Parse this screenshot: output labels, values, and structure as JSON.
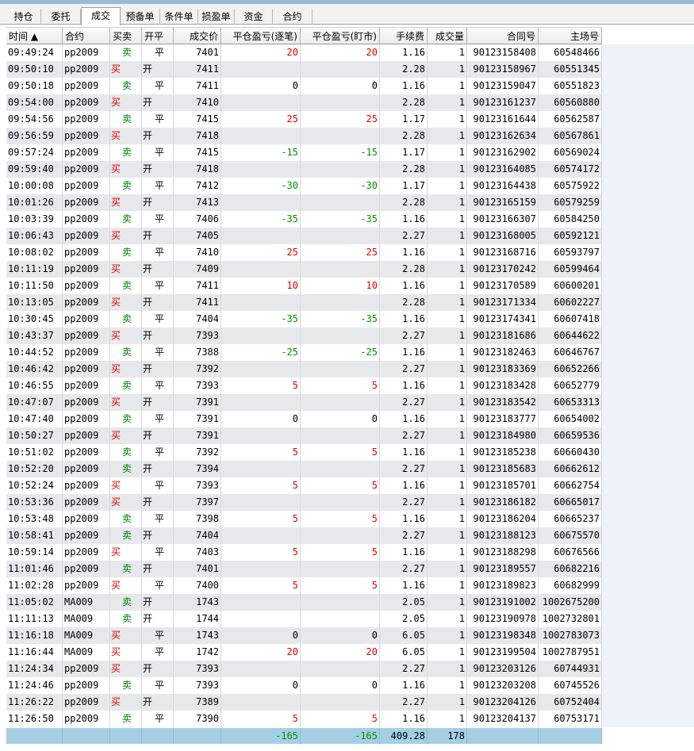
{
  "tabs": [
    {
      "label": "持仓",
      "active": false
    },
    {
      "label": "委托",
      "active": false
    },
    {
      "label": "成交",
      "active": true
    },
    {
      "label": "预备单",
      "active": false
    },
    {
      "label": "条件单",
      "active": false
    },
    {
      "label": "损盈单",
      "active": false
    },
    {
      "label": "资金",
      "active": false
    },
    {
      "label": "合约",
      "active": false
    }
  ],
  "columns": [
    "时间 ▲",
    "合约",
    "买卖",
    "开平",
    "成交价",
    "平仓盈亏(逐笔)",
    "平仓盈亏(盯市)",
    "手续费",
    "成交量",
    "合同号",
    "主场号"
  ],
  "colors": {
    "buy": "#e00000",
    "sell": "#008000",
    "loss": "#009000",
    "profit": "#e00000",
    "total_bg": "#a6cfe6"
  },
  "rows": [
    [
      "09:49:24",
      "pp2009",
      "卖",
      "平",
      "7401",
      "20",
      "20",
      "1.16",
      "1",
      "90123158408",
      "60548466"
    ],
    [
      "09:50:10",
      "pp2009",
      "买",
      "开",
      "7411",
      "",
      "",
      "2.28",
      "1",
      "90123158967",
      "60551345"
    ],
    [
      "09:50:18",
      "pp2009",
      "卖",
      "平",
      "7411",
      "0",
      "0",
      "1.16",
      "1",
      "90123159047",
      "60551823"
    ],
    [
      "09:54:00",
      "pp2009",
      "买",
      "开",
      "7410",
      "",
      "",
      "2.28",
      "1",
      "90123161237",
      "60560880"
    ],
    [
      "09:54:56",
      "pp2009",
      "卖",
      "平",
      "7415",
      "25",
      "25",
      "1.17",
      "1",
      "90123161644",
      "60562587"
    ],
    [
      "09:56:59",
      "pp2009",
      "买",
      "开",
      "7418",
      "",
      "",
      "2.28",
      "1",
      "90123162634",
      "60567861"
    ],
    [
      "09:57:24",
      "pp2009",
      "卖",
      "平",
      "7415",
      "-15",
      "-15",
      "1.17",
      "1",
      "90123162902",
      "60569024"
    ],
    [
      "09:59:40",
      "pp2009",
      "买",
      "开",
      "7418",
      "",
      "",
      "2.28",
      "1",
      "90123164085",
      "60574172"
    ],
    [
      "10:00:08",
      "pp2009",
      "卖",
      "平",
      "7412",
      "-30",
      "-30",
      "1.17",
      "1",
      "90123164438",
      "60575922"
    ],
    [
      "10:01:26",
      "pp2009",
      "买",
      "开",
      "7413",
      "",
      "",
      "2.28",
      "1",
      "90123165159",
      "60579259"
    ],
    [
      "10:03:39",
      "pp2009",
      "卖",
      "平",
      "7406",
      "-35",
      "-35",
      "1.16",
      "1",
      "90123166307",
      "60584250"
    ],
    [
      "10:06:43",
      "pp2009",
      "买",
      "开",
      "7405",
      "",
      "",
      "2.27",
      "1",
      "90123168005",
      "60592121"
    ],
    [
      "10:08:02",
      "pp2009",
      "卖",
      "平",
      "7410",
      "25",
      "25",
      "1.16",
      "1",
      "90123168716",
      "60593797"
    ],
    [
      "10:11:19",
      "pp2009",
      "买",
      "开",
      "7409",
      "",
      "",
      "2.28",
      "1",
      "90123170242",
      "60599464"
    ],
    [
      "10:11:50",
      "pp2009",
      "卖",
      "平",
      "7411",
      "10",
      "10",
      "1.16",
      "1",
      "90123170589",
      "60600201"
    ],
    [
      "10:13:05",
      "pp2009",
      "买",
      "开",
      "7411",
      "",
      "",
      "2.28",
      "1",
      "90123171334",
      "60602227"
    ],
    [
      "10:30:45",
      "pp2009",
      "卖",
      "平",
      "7404",
      "-35",
      "-35",
      "1.16",
      "1",
      "90123174341",
      "60607418"
    ],
    [
      "10:43:37",
      "pp2009",
      "买",
      "开",
      "7393",
      "",
      "",
      "2.27",
      "1",
      "90123181686",
      "60644622"
    ],
    [
      "10:44:52",
      "pp2009",
      "卖",
      "平",
      "7388",
      "-25",
      "-25",
      "1.16",
      "1",
      "90123182463",
      "60646767"
    ],
    [
      "10:46:42",
      "pp2009",
      "买",
      "开",
      "7392",
      "",
      "",
      "2.27",
      "1",
      "90123183369",
      "60652266"
    ],
    [
      "10:46:55",
      "pp2009",
      "卖",
      "平",
      "7393",
      "5",
      "5",
      "1.16",
      "1",
      "90123183428",
      "60652779"
    ],
    [
      "10:47:07",
      "pp2009",
      "买",
      "开",
      "7391",
      "",
      "",
      "2.27",
      "1",
      "90123183542",
      "60653313"
    ],
    [
      "10:47:40",
      "pp2009",
      "卖",
      "平",
      "7391",
      "0",
      "0",
      "1.16",
      "1",
      "90123183777",
      "60654002"
    ],
    [
      "10:50:27",
      "pp2009",
      "买",
      "开",
      "7391",
      "",
      "",
      "2.27",
      "1",
      "90123184980",
      "60659536"
    ],
    [
      "10:51:02",
      "pp2009",
      "卖",
      "平",
      "7392",
      "5",
      "5",
      "1.16",
      "1",
      "90123185238",
      "60660430"
    ],
    [
      "10:52:20",
      "pp2009",
      "卖",
      "开",
      "7394",
      "",
      "",
      "2.27",
      "1",
      "90123185683",
      "60662612"
    ],
    [
      "10:52:24",
      "pp2009",
      "买",
      "平",
      "7393",
      "5",
      "5",
      "1.16",
      "1",
      "90123185701",
      "60662754"
    ],
    [
      "10:53:36",
      "pp2009",
      "买",
      "开",
      "7397",
      "",
      "",
      "2.27",
      "1",
      "90123186182",
      "60665017"
    ],
    [
      "10:53:48",
      "pp2009",
      "卖",
      "平",
      "7398",
      "5",
      "5",
      "1.16",
      "1",
      "90123186204",
      "60665237"
    ],
    [
      "10:58:41",
      "pp2009",
      "卖",
      "开",
      "7404",
      "",
      "",
      "2.27",
      "1",
      "90123188123",
      "60675570"
    ],
    [
      "10:59:14",
      "pp2009",
      "买",
      "平",
      "7403",
      "5",
      "5",
      "1.16",
      "1",
      "90123188298",
      "60676566"
    ],
    [
      "11:01:46",
      "pp2009",
      "卖",
      "开",
      "7401",
      "",
      "",
      "2.27",
      "1",
      "90123189557",
      "60682216"
    ],
    [
      "11:02:28",
      "pp2009",
      "买",
      "平",
      "7400",
      "5",
      "5",
      "1.16",
      "1",
      "90123189823",
      "60682999"
    ],
    [
      "11:05:02",
      "MA009",
      "卖",
      "开",
      "1743",
      "",
      "",
      "2.05",
      "1",
      "90123191002",
      "1002675200"
    ],
    [
      "11:11:13",
      "MA009",
      "卖",
      "开",
      "1744",
      "",
      "",
      "2.05",
      "1",
      "90123190978",
      "1002732801"
    ],
    [
      "11:16:18",
      "MA009",
      "买",
      "平",
      "1743",
      "0",
      "0",
      "6.05",
      "1",
      "90123198348",
      "1002783073"
    ],
    [
      "11:16:44",
      "MA009",
      "买",
      "平",
      "1742",
      "20",
      "20",
      "6.05",
      "1",
      "90123199504",
      "1002787951"
    ],
    [
      "11:24:34",
      "pp2009",
      "买",
      "开",
      "7393",
      "",
      "",
      "2.27",
      "1",
      "90123203126",
      "60744931"
    ],
    [
      "11:24:46",
      "pp2009",
      "卖",
      "平",
      "7393",
      "0",
      "0",
      "1.16",
      "1",
      "90123203208",
      "60745526"
    ],
    [
      "11:26:22",
      "pp2009",
      "买",
      "开",
      "7389",
      "",
      "",
      "2.27",
      "1",
      "90123204126",
      "60752404"
    ],
    [
      "11:26:50",
      "pp2009",
      "卖",
      "平",
      "7390",
      "5",
      "5",
      "1.16",
      "1",
      "90123204137",
      "60753171"
    ]
  ],
  "totals": {
    "pnl_trade": "-165",
    "pnl_mark": "-165",
    "fee": "409.28",
    "volume": "178"
  }
}
